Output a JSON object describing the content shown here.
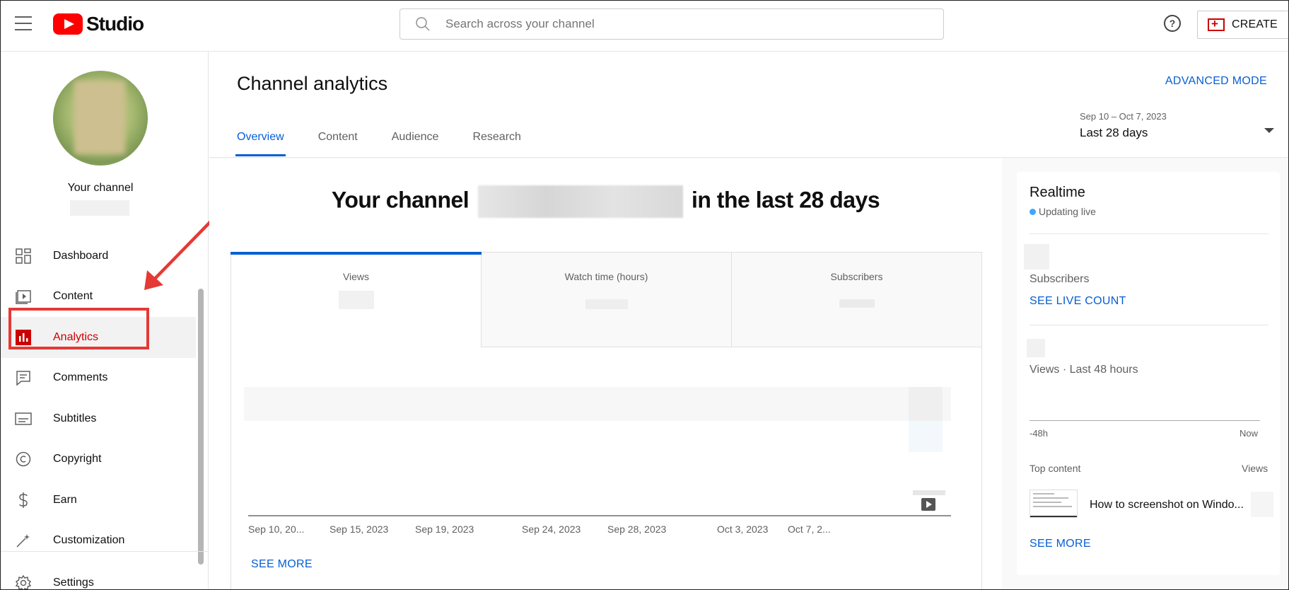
{
  "header": {
    "logo_text": "Studio",
    "search_placeholder": "Search across your channel",
    "help_label": "?",
    "create_label": "CREATE"
  },
  "sidebar": {
    "channel_label": "Your channel",
    "items": [
      {
        "label": "Dashboard",
        "icon": "dashboard-icon"
      },
      {
        "label": "Content",
        "icon": "content-icon"
      },
      {
        "label": "Analytics",
        "icon": "analytics-icon",
        "active": true
      },
      {
        "label": "Comments",
        "icon": "comments-icon"
      },
      {
        "label": "Subtitles",
        "icon": "subtitles-icon"
      },
      {
        "label": "Copyright",
        "icon": "copyright-icon"
      },
      {
        "label": "Earn",
        "icon": "earn-icon"
      },
      {
        "label": "Customization",
        "icon": "customization-icon"
      }
    ],
    "settings_label": "Settings"
  },
  "main": {
    "title": "Channel analytics",
    "advanced_mode": "ADVANCED MODE",
    "tabs": [
      {
        "label": "Overview",
        "active": true
      },
      {
        "label": "Content"
      },
      {
        "label": "Audience"
      },
      {
        "label": "Research"
      }
    ],
    "date_range": {
      "dates": "Sep 10 – Oct 7, 2023",
      "label": "Last 28 days"
    },
    "headline_prefix": "Your channel",
    "headline_suffix": "in the last 28 days",
    "metrics": [
      {
        "label": "Views",
        "active": true
      },
      {
        "label": "Watch time (hours)"
      },
      {
        "label": "Subscribers"
      }
    ],
    "x_ticks": [
      "Sep 10, 20...",
      "Sep 15, 2023",
      "Sep 19, 2023",
      "Sep 24, 2023",
      "Sep 28, 2023",
      "Oct 3, 2023",
      "Oct 7, 2..."
    ],
    "see_more": "SEE MORE"
  },
  "realtime": {
    "title": "Realtime",
    "live_label": "Updating live",
    "subscribers_label": "Subscribers",
    "see_live_count": "SEE LIVE COUNT",
    "views_label": "Views · Last 48 hours",
    "axis_start": "-48h",
    "axis_end": "Now",
    "top_content_label": "Top content",
    "top_content_views_label": "Views",
    "top_video_title": "How to screenshot on Windo...",
    "see_more": "SEE MORE"
  },
  "colors": {
    "accent_blue": "#065fd4",
    "brand_red": "#ff0000",
    "active_red": "#cc0000",
    "annotation_red": "#e53935"
  }
}
